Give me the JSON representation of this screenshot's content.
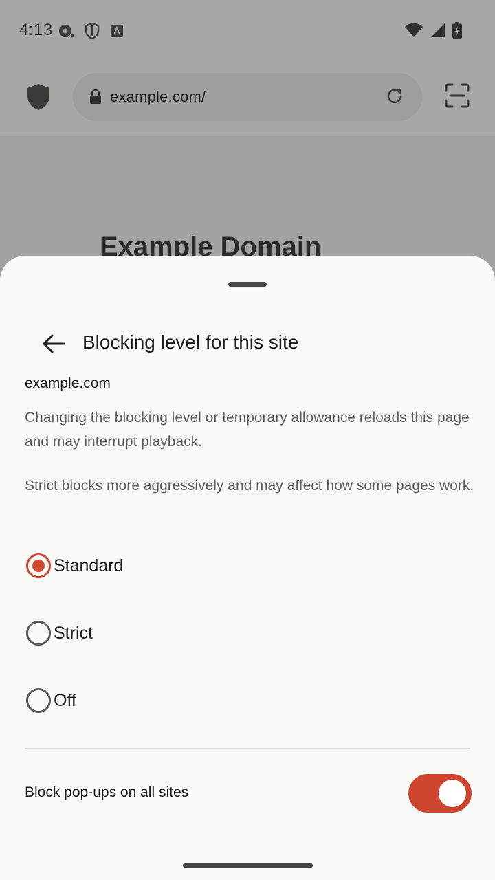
{
  "status_bar": {
    "time": "4:13",
    "left_icons": [
      "media-record-icon",
      "shield-outline-icon",
      "font-a-icon"
    ],
    "right_icons": [
      "wifi-icon",
      "cellular-signal-icon",
      "battery-charging-icon"
    ]
  },
  "toolbar": {
    "url": "example.com/",
    "icons": [
      "shield-icon",
      "lock-icon",
      "reload-icon",
      "scan-icon"
    ]
  },
  "web_content": {
    "heading": "Example Domain"
  },
  "sheet": {
    "title": "Blocking level for this site",
    "site": "example.com",
    "description_1": "Changing the blocking level or temporary allowance reloads this page and may interrupt playback.",
    "description_2": "Strict blocks more aggressively and may affect how some pages work.",
    "options": [
      {
        "label": "Standard",
        "selected": true
      },
      {
        "label": "Strict",
        "selected": false
      },
      {
        "label": "Off",
        "selected": false
      }
    ],
    "popup_label": "Block pop-ups on all sites",
    "popup_enabled": true
  },
  "colors": {
    "accent": "#cf4630",
    "sheet_bg": "#f9f9f7",
    "scrim": "#a6a6a5"
  }
}
